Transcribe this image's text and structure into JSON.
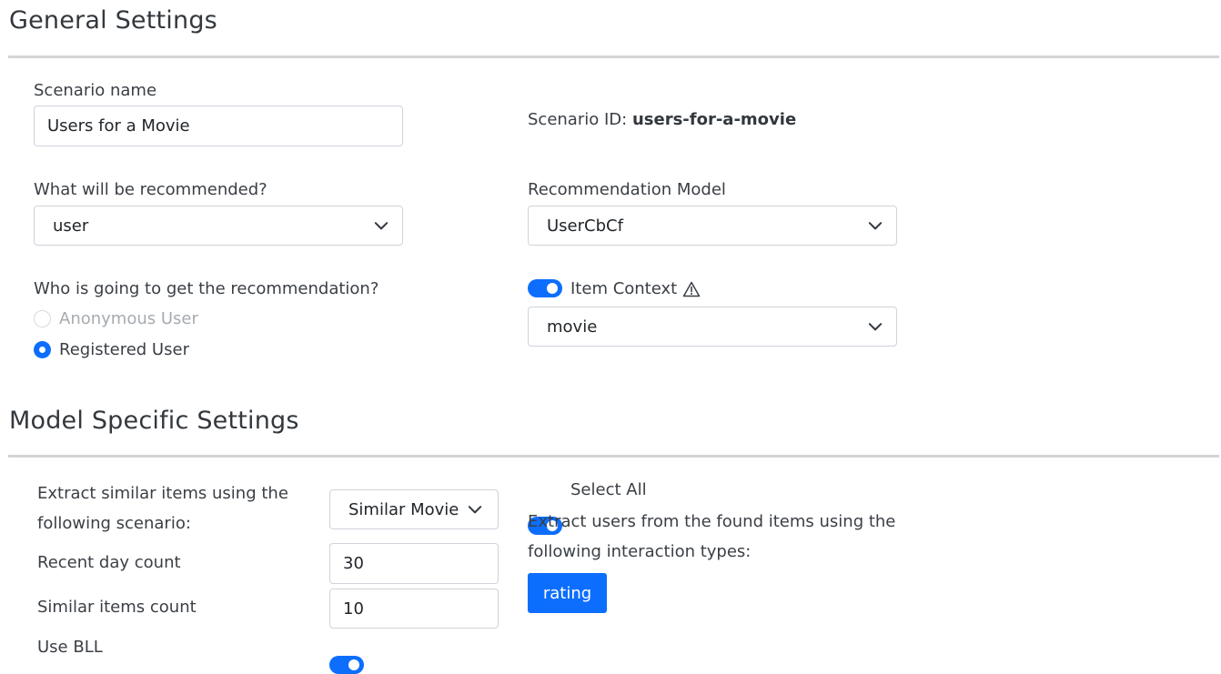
{
  "general": {
    "title": "General Settings",
    "scenario_name": {
      "label": "Scenario name",
      "value": "Users for a Movie"
    },
    "scenario_id": {
      "label": "Scenario ID:",
      "value": "users-for-a-movie"
    },
    "recommended": {
      "label": "What will be recommended?",
      "value": "user"
    },
    "model": {
      "label": "Recommendation Model",
      "value": "UserCbCf"
    },
    "audience": {
      "label": "Who is going to get the recommendation?",
      "options": [
        {
          "label": "Anonymous User",
          "selected": false,
          "disabled": true
        },
        {
          "label": "Registered User",
          "selected": true,
          "disabled": false
        }
      ]
    },
    "item_context": {
      "label": "Item Context",
      "enabled": true,
      "warning_icon": "warning-icon",
      "value": "movie"
    }
  },
  "model_specific": {
    "title": "Model Specific Settings",
    "extract_scenario": {
      "label_line1": "Extract similar items using the",
      "label_line2": "following scenario:",
      "value": "Similar Movie"
    },
    "recent_day_count": {
      "label": "Recent day count",
      "value": "30"
    },
    "similar_items_count": {
      "label": "Similar items count",
      "value": "10"
    },
    "use_bll": {
      "label": "Use BLL",
      "enabled": true
    },
    "select_all": {
      "label": "Select All",
      "enabled": true
    },
    "interaction": {
      "label_line1": "Extract users from the found items using the",
      "label_line2": "following interaction types:",
      "types": [
        "rating"
      ]
    }
  },
  "colors": {
    "accent": "#0d6efd",
    "rule": "#d2d4d6",
    "border": "#ced4da",
    "muted_text": "#a6abb0"
  }
}
